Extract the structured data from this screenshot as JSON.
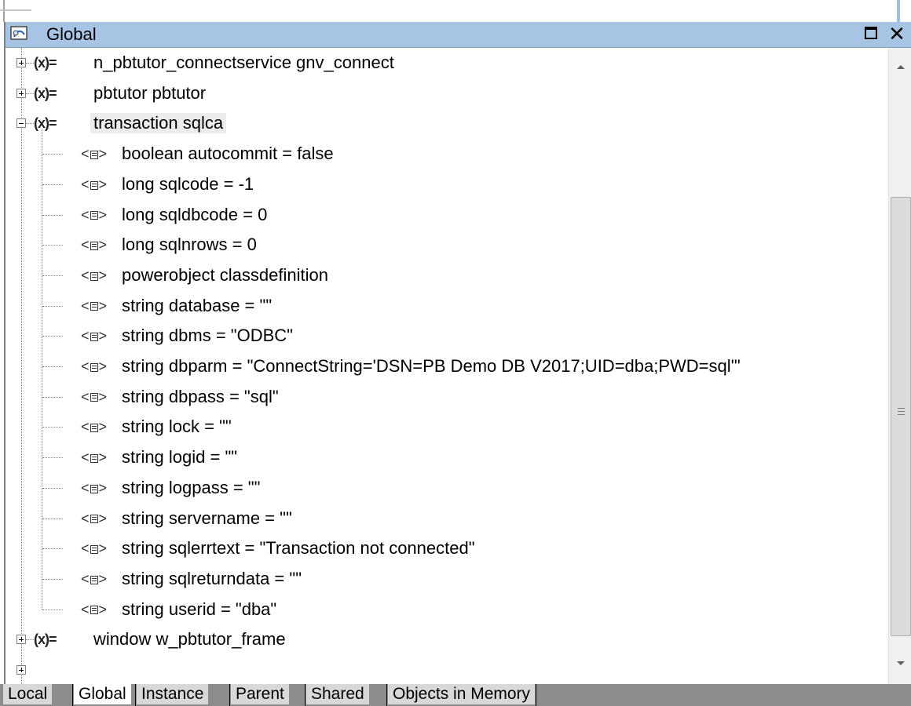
{
  "panel": {
    "title": "Global",
    "maximize_icon": "maximize-icon",
    "close_icon": "close-icon"
  },
  "tree": {
    "globals": [
      {
        "label": "n_pbtutor_connectservice gnv_connect",
        "expanded": false
      },
      {
        "label": "pbtutor pbtutor",
        "expanded": false
      },
      {
        "label": "transaction sqlca",
        "expanded": true
      }
    ],
    "properties": [
      "boolean autocommit = false",
      "long sqlcode = -1",
      "long sqldbcode = 0",
      "long sqlnrows = 0",
      "powerobject classdefinition",
      "string database = \"\"",
      "string dbms = \"ODBC\"",
      "string dbparm = \"ConnectString='DSN=PB Demo DB V2017;UID=dba;PWD=sql'\"",
      "string dbpass = \"sql\"",
      "string lock = \"\"",
      "string logid = \"\"",
      "string logpass = \"\"",
      "string servername = \"\"",
      "string sqlerrtext = \"Transaction not connected\"",
      "string sqlreturndata = \"\"",
      "string userid = \"dba\""
    ],
    "trailing": [
      {
        "label": "window w_pbtutor_frame",
        "expanded": false
      }
    ],
    "variable_glyph": "(x)=",
    "property_glyph_left": "<",
    "property_glyph_right": ">"
  },
  "tabs": [
    {
      "label": "Local",
      "active": false
    },
    {
      "label": "Global",
      "active": true
    },
    {
      "label": "Instance",
      "active": false
    },
    {
      "label": "Parent",
      "active": false
    },
    {
      "label": "Shared",
      "active": false
    },
    {
      "label": "Objects in Memory",
      "active": false
    }
  ]
}
